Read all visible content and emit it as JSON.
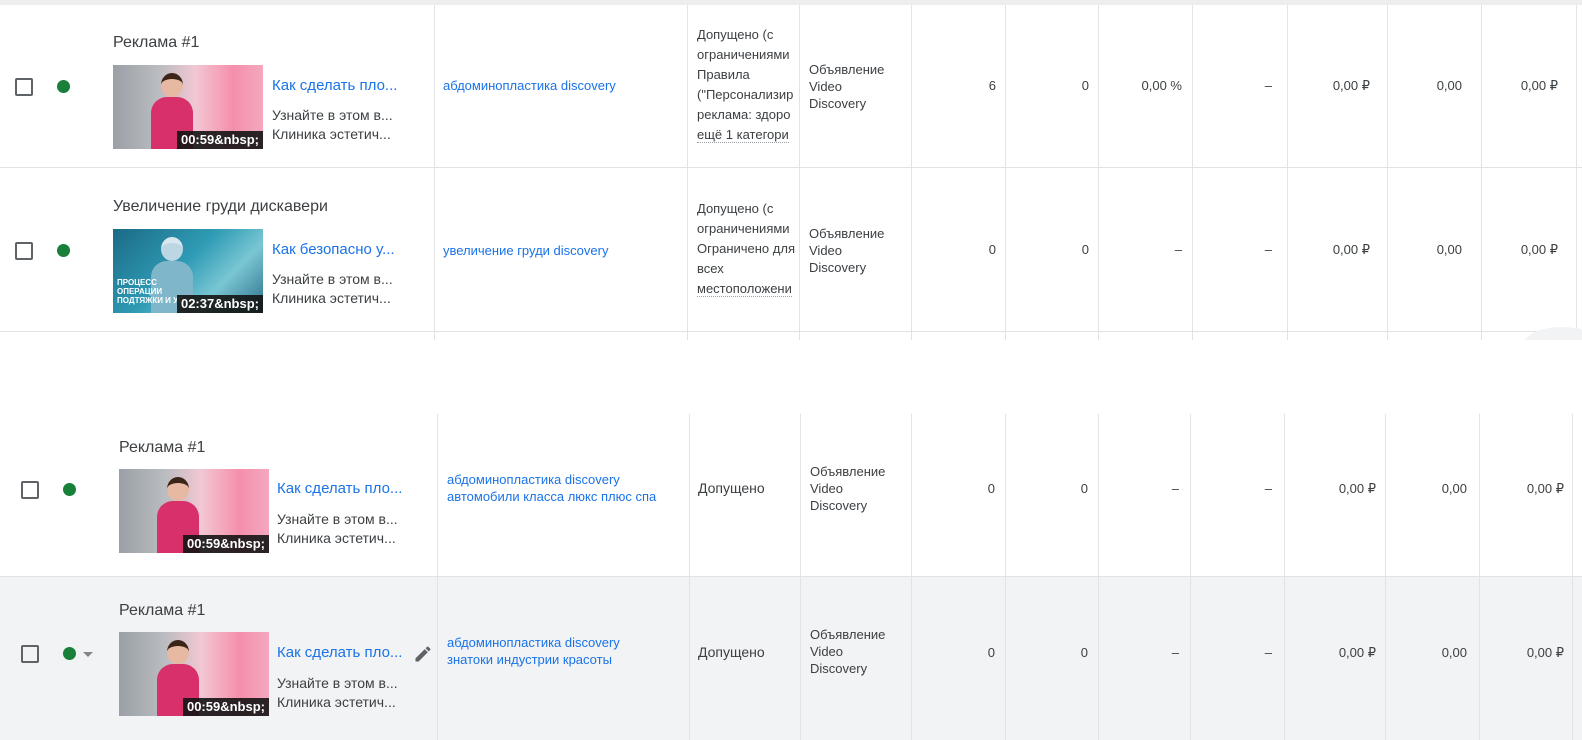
{
  "rows": [
    {
      "ad_title": "Реклама #1",
      "thumb_duration": "00:59&nbsp;",
      "video_title": "Как сделать пло...",
      "desc_line1": "Узнайте в этом в...",
      "desc_line2": "Клиника эстетич...",
      "ad_group_line1": "абдоминопластика discovery",
      "ad_group_line2": "",
      "status_lines": [
        "Допущено (с",
        "ограничениями",
        "Правила",
        "(\"Персонализир",
        "реклама: здоро",
        "ещё 1 категори"
      ],
      "type_lines": [
        "Объявление",
        "Video",
        "Discovery"
      ],
      "metrics": [
        "6",
        "0",
        "0,00 %",
        "–",
        "0,00 ₽",
        "0,00",
        "0,00 ₽"
      ]
    },
    {
      "ad_title": "Увеличение груди дискавери",
      "thumb_duration": "02:37&nbsp;",
      "thumb_caption": "ПРОЦЕСС ОПЕРАЦИИ ПОДТЯЖКИ И УВ",
      "video_title": "Как безопасно у...",
      "desc_line1": "Узнайте в этом в...",
      "desc_line2": "Клиника эстетич...",
      "ad_group_line1": "увеличение груди discovery",
      "ad_group_line2": "",
      "status_lines": [
        "Допущено (с",
        "ограничениями",
        "Ограничено для",
        "всех",
        "местоположени"
      ],
      "type_lines": [
        "Объявление",
        "Video",
        "Discovery"
      ],
      "metrics": [
        "0",
        "0",
        "–",
        "–",
        "0,00 ₽",
        "0,00",
        "0,00 ₽"
      ]
    },
    {
      "ad_title": "Реклама #1",
      "thumb_duration": "00:59&nbsp;",
      "video_title": "Как сделать пло...",
      "desc_line1": "Узнайте в этом в...",
      "desc_line2": "Клиника эстетич...",
      "ad_group_line1": "абдоминопластика discovery",
      "ad_group_line2": "автомобили класса люкс плюс спа",
      "status_lines": [
        "Допущено"
      ],
      "type_lines": [
        "Объявление",
        "Video",
        "Discovery"
      ],
      "metrics": [
        "0",
        "0",
        "–",
        "–",
        "0,00 ₽",
        "0,00",
        "0,00 ₽"
      ]
    },
    {
      "ad_title": "Реклама #1",
      "thumb_duration": "00:59&nbsp;",
      "video_title": "Как сделать пло...",
      "desc_line1": "Узнайте в этом в...",
      "desc_line2": "Клиника эстетич...",
      "ad_group_line1": "абдоминопластика discovery",
      "ad_group_line2": "знатоки индустрии красоты",
      "status_lines": [
        "Допущено"
      ],
      "type_lines": [
        "Объявление",
        "Video",
        "Discovery"
      ],
      "metrics": [
        "0",
        "0",
        "–",
        "–",
        "0,00 ₽",
        "0,00",
        "0,00 ₽"
      ]
    }
  ],
  "colors": {
    "status_enabled": "#188038",
    "link": "#1a73e8",
    "text": "#3c4043",
    "row_hover": "#f1f3f4"
  }
}
